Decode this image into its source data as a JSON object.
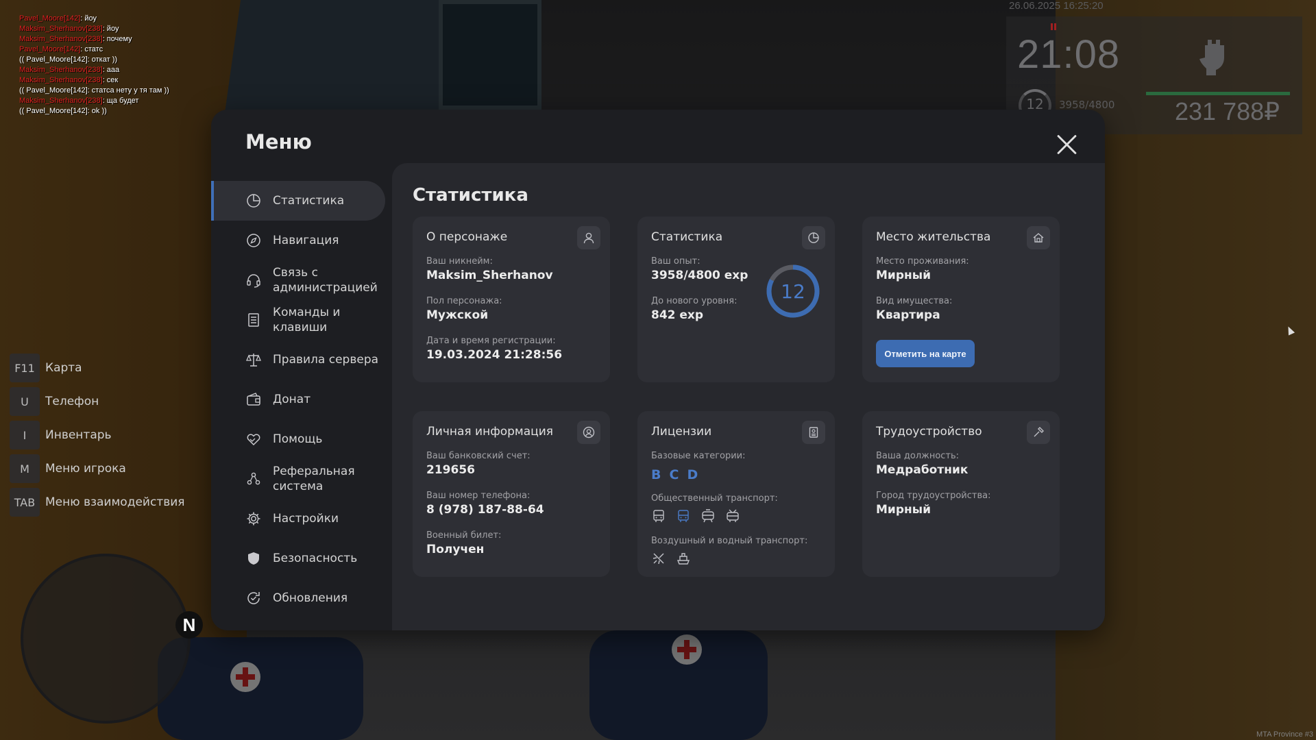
{
  "chat": [
    {
      "nick": "Pavel_Moore[142]",
      "text": ": йоу",
      "type": "ic"
    },
    {
      "nick": "Maksim_Sherhanov[238]",
      "text": ": йоу",
      "type": "ic"
    },
    {
      "nick": "Maksim_Sherhanov[238]",
      "text": ": почему",
      "type": "ic"
    },
    {
      "nick": "Pavel_Moore[142]",
      "text": ": статс",
      "type": "ic"
    },
    {
      "nick": "",
      "text": "(( Pavel_Moore[142]: откат ))",
      "type": "ooc"
    },
    {
      "nick": "Maksim_Sherhanov[238]",
      "text": ": ааа",
      "type": "ic"
    },
    {
      "nick": "Maksim_Sherhanov[238]",
      "text": ": сек",
      "type": "ic"
    },
    {
      "nick": "",
      "text": "(( Pavel_Moore[142]: статса нету у тя там ))",
      "type": "ooc"
    },
    {
      "nick": "Maksim_Sherhanov[238]",
      "text": ": ща будет",
      "type": "ic"
    },
    {
      "nick": "",
      "text": "(( Pavel_Moore[142]: ok ))",
      "type": "ooc"
    }
  ],
  "hud": {
    "datetime": "26.06.2025 16:25:20",
    "time": "21:08",
    "level": "12",
    "exp": "3958/4800",
    "money": "231 788₽",
    "bar_fill_percent": 100
  },
  "keys": [
    {
      "key": "F11",
      "label": "Карта"
    },
    {
      "key": "U",
      "label": "Телефон"
    },
    {
      "key": "I",
      "label": "Инвентарь"
    },
    {
      "key": "M",
      "label": "Меню игрока"
    },
    {
      "key": "TAB",
      "label": "Меню взаимодействия"
    }
  ],
  "radar": {
    "north": "N"
  },
  "watermark": "MTA Province #3",
  "menu": {
    "title": "Меню",
    "sidebar": [
      {
        "label": "Статистика",
        "icon": "pie-chart-icon",
        "active": true
      },
      {
        "label": "Навигация",
        "icon": "compass-icon"
      },
      {
        "label": "Связь с администрацией",
        "icon": "headset-icon"
      },
      {
        "label": "Команды и клавиши",
        "icon": "document-list-icon"
      },
      {
        "label": "Правила сервера",
        "icon": "scales-icon"
      },
      {
        "label": "Донат",
        "icon": "wallet-icon"
      },
      {
        "label": "Помощь",
        "icon": "heart-hands-icon"
      },
      {
        "label": "Реферальная система",
        "icon": "people-network-icon"
      },
      {
        "label": "Настройки",
        "icon": "gear-icon"
      },
      {
        "label": "Безопасность",
        "icon": "shield-icon"
      },
      {
        "label": "Обновления",
        "icon": "refresh-check-icon"
      }
    ],
    "content_title": "Статистика",
    "cards": {
      "character": {
        "title": "О персонаже",
        "icon": "user-icon",
        "nick_label": "Ваш никнейм:",
        "nick": "Maksim_Sherhanov",
        "gender_label": "Пол персонажа:",
        "gender": "Мужской",
        "reg_label": "Дата и время регистрации:",
        "reg": "19.03.2024 21:28:56"
      },
      "stats": {
        "title": "Статистика",
        "icon": "pie-chart-icon",
        "exp_label": "Ваш опыт:",
        "exp": "3958/4800 exp",
        "next_label": "До нового уровня:",
        "next": "842 exp",
        "level": "12",
        "level_progress": 0.8246
      },
      "residence": {
        "title": "Место жительства",
        "icon": "house-icon",
        "place_label": "Место проживания:",
        "place": "Мирный",
        "property_label": "Вид имущества:",
        "property": "Квартира",
        "map_button": "Отметить на карте"
      },
      "personal": {
        "title": "Личная информация",
        "icon": "user-circle-icon",
        "bank_label": "Ваш банковский счет:",
        "bank": "219656",
        "phone_label": "Ваш номер телефона:",
        "phone": "8 (978) 187-88-64",
        "military_label": "Военный билет:",
        "military": "Получен"
      },
      "licenses": {
        "title": "Лицензии",
        "icon": "id-card-icon",
        "base_label": "Базовые категории:",
        "categories": [
          "B",
          "C",
          "D"
        ],
        "public_label": "Общественный транспорт:",
        "public_icons": [
          "bus-icon",
          "bus-active-icon",
          "tram-icon",
          "trolleybus-icon"
        ],
        "air_label": "Воздушный и водный транспорт:",
        "air_icons": [
          "plane-icon",
          "boat-icon"
        ],
        "accent": "#4a7cc9"
      },
      "job": {
        "title": "Трудоустройство",
        "icon": "hammer-icon",
        "position_label": "Ваша должность:",
        "position": "Медработник",
        "city_label": "Город трудоустройства:",
        "city": "Мирный"
      }
    }
  }
}
